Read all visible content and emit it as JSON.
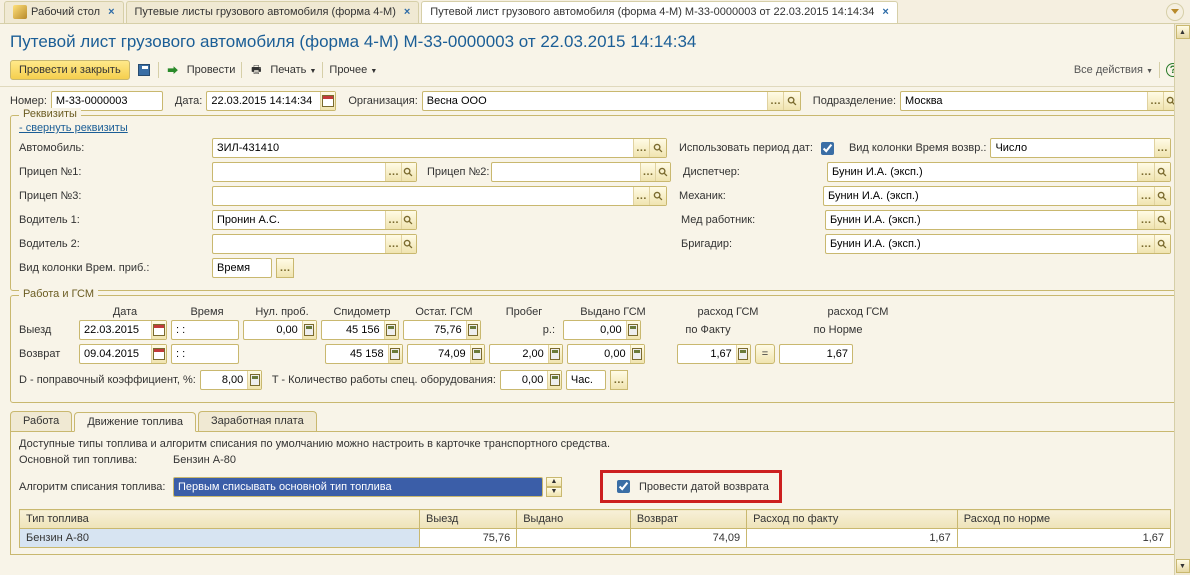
{
  "tabs": {
    "desktop": "Рабочий стол",
    "tab2": "Путевые листы грузового автомобиля (форма 4-М)",
    "tab3": "Путевой лист грузового автомобиля (форма 4-М) М-33-0000003 от 22.03.2015 14:14:34"
  },
  "title": "Путевой лист грузового автомобиля (форма 4-М) М-33-0000003 от 22.03.2015 14:14:34",
  "toolbar": {
    "post_close": "Провести и закрыть",
    "post": "Провести",
    "print": "Печать",
    "more": "Прочее",
    "all_actions": "Все действия"
  },
  "header_row": {
    "number_lbl": "Номер:",
    "number_val": "М-33-0000003",
    "date_lbl": "Дата:",
    "date_val": "22.03.2015 14:14:34",
    "org_lbl": "Организация:",
    "org_val": "Весна ООО",
    "dept_lbl": "Подразделение:",
    "dept_val": "Москва"
  },
  "requisites": {
    "legend": "Реквизиты",
    "collapse_link": "- свернуть реквизиты",
    "auto_lbl": "Автомобиль:",
    "auto_val": "ЗИЛ-431410",
    "use_date_period": "Использовать период дат:",
    "return_col_lbl": "Вид колонки Время возвр.:",
    "return_col_val": "Число",
    "trailer1_lbl": "Прицеп №1:",
    "trailer2_lbl": "Прицеп №2:",
    "trailer3_lbl": "Прицеп №3:",
    "dispatcher_lbl": "Диспетчер:",
    "dispatcher_val": "Бунин И.А. (эксп.)",
    "mechanic_lbl": "Механик:",
    "mechanic_val": "Бунин И.А. (эксп.)",
    "driver1_lbl": "Водитель 1:",
    "driver1_val": "Пронин А.С.",
    "medic_lbl": "Мед работник:",
    "medic_val": "Бунин И.А. (эксп.)",
    "driver2_lbl": "Водитель 2:",
    "foreman_lbl": "Бригадир:",
    "foreman_val": "Бунин И.А. (эксп.)",
    "arrive_col_lbl": "Вид колонки Врем. приб.:",
    "arrive_col_val": "Время"
  },
  "work_gsm": {
    "legend": "Работа и ГСМ",
    "cols": {
      "date": "Дата",
      "time": "Время",
      "zero_run": "Нул. проб.",
      "odometer": "Спидометр",
      "fuel_rest": "Остат. ГСМ",
      "run": "Пробег",
      "fuel_iss": "Выдано ГСМ",
      "fuel_cons": "расход ГСМ",
      "fuel_cons2": "расход ГСМ"
    },
    "departure_lbl": "Выезд",
    "return_lbl": "Возврат",
    "departure": {
      "date": "22.03.2015",
      "time": ": :",
      "nul_run": "0,00",
      "odo": "45 156",
      "rest": "75,76",
      "run_unit": "р.:",
      "fuel_iss": "0,00",
      "fact_lbl": "по Факту",
      "norm_lbl": "по Норме"
    },
    "return": {
      "date": "09.04.2015",
      "time": ": :",
      "odo": "45 158",
      "rest": "74,09",
      "run": "2,00",
      "fuel_iss": "0,00",
      "fact": "1,67",
      "eq": "=",
      "norm": "1,67"
    },
    "d_coef_lbl": "D - поправочный коэффициент, %:",
    "d_coef_val": "8,00",
    "t_lbl": "T - Количество работы спец. оборудования:",
    "t_val": "0,00",
    "t_unit": "Час."
  },
  "subtabs": {
    "work": "Работа",
    "fuel": "Движение топлива",
    "salary": "Заработная плата"
  },
  "fuel_tab": {
    "note": "Доступные типы топлива и алгоритм списания по умолчанию можно настроить в карточке транспортного средства.",
    "main_fuel_lbl": "Основной тип топлива:",
    "main_fuel_val": "Бензин А-80",
    "algo_lbl": "Алгоритм списания топлива:",
    "algo_val": "Первым списывать основной тип топлива",
    "post_return_cb": "Провести датой возврата",
    "cols": {
      "type": "Тип топлива",
      "dep": "Выезд",
      "iss": "Выдано",
      "ret": "Возврат",
      "fact": "Расход по факту",
      "norm": "Расход по норме"
    },
    "row": {
      "type": "Бензин А-80",
      "dep": "75,76",
      "iss": "",
      "ret": "74,09",
      "fact": "1,67",
      "norm": "1,67"
    }
  }
}
